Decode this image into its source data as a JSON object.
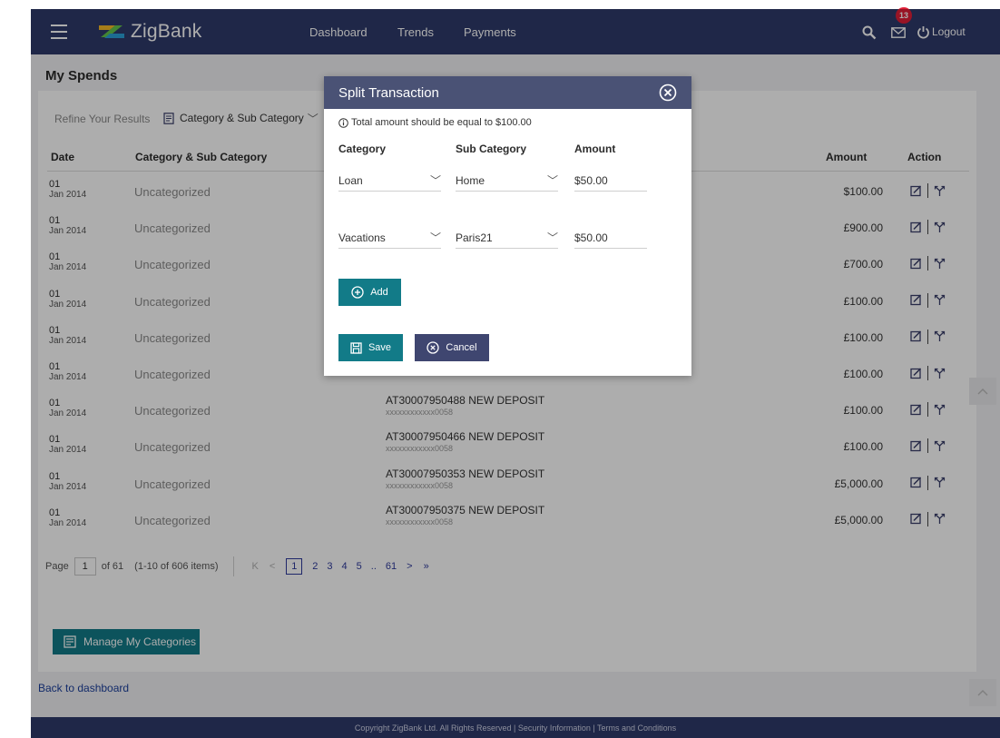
{
  "header": {
    "brand": "ZigBank",
    "nav": [
      "Dashboard",
      "Trends",
      "Payments"
    ],
    "mail_badge": "13",
    "logout": "Logout"
  },
  "page": {
    "title": "My Spends",
    "refine_label": "Refine Your Results",
    "refine_select": "Category & Sub Category",
    "columns": {
      "date": "Date",
      "category": "Category & Sub Category",
      "amount": "Amount",
      "action": "Action"
    },
    "rows": [
      {
        "day": "01",
        "month": "Jan 2014",
        "category": "Uncategorized",
        "desc": "",
        "acct": "",
        "amount": "$100.00"
      },
      {
        "day": "01",
        "month": "Jan 2014",
        "category": "Uncategorized",
        "desc": "",
        "acct": "",
        "amount": "£900.00"
      },
      {
        "day": "01",
        "month": "Jan 2014",
        "category": "Uncategorized",
        "desc": "",
        "acct": "",
        "amount": "£700.00"
      },
      {
        "day": "01",
        "month": "Jan 2014",
        "category": "Uncategorized",
        "desc": "",
        "acct": "",
        "amount": "£100.00"
      },
      {
        "day": "01",
        "month": "Jan 2014",
        "category": "Uncategorized",
        "desc": "",
        "acct": "",
        "amount": "£100.00"
      },
      {
        "day": "01",
        "month": "Jan 2014",
        "category": "Uncategorized",
        "desc": "",
        "acct": "xxxxxxxxxxxx0058",
        "amount": "£100.00"
      },
      {
        "day": "01",
        "month": "Jan 2014",
        "category": "Uncategorized",
        "desc": "AT30007950488 NEW DEPOSIT",
        "acct": "xxxxxxxxxxxx0058",
        "amount": "£100.00"
      },
      {
        "day": "01",
        "month": "Jan 2014",
        "category": "Uncategorized",
        "desc": "AT30007950466 NEW DEPOSIT",
        "acct": "xxxxxxxxxxxx0058",
        "amount": "£100.00"
      },
      {
        "day": "01",
        "month": "Jan 2014",
        "category": "Uncategorized",
        "desc": "AT30007950353 NEW DEPOSIT",
        "acct": "xxxxxxxxxxxx0058",
        "amount": "£5,000.00"
      },
      {
        "day": "01",
        "month": "Jan 2014",
        "category": "Uncategorized",
        "desc": "AT30007950375 NEW DEPOSIT",
        "acct": "xxxxxxxxxxxx0058",
        "amount": "£5,000.00"
      }
    ],
    "pagination": {
      "page_label": "Page",
      "current": "1",
      "of_label": "of 61",
      "items": "(1-10 of 606 items)",
      "first": "K",
      "prev": "<",
      "pages": [
        "2",
        "3",
        "4",
        "5"
      ],
      "ellipsis": "..",
      "last_page": "61",
      "next": ">",
      "last": "»"
    },
    "manage_button": "Manage My Categories",
    "back_link": "Back to dashboard"
  },
  "footer": "Copyright ZigBank Ltd. All Rights Reserved | Security Information | Terms and Conditions",
  "modal": {
    "title": "Split Transaction",
    "note": "Total amount should be equal to $100.00",
    "col_category": "Category",
    "col_subcategory": "Sub Category",
    "col_amount": "Amount",
    "splits": [
      {
        "category": "Loan",
        "subcategory": "Home",
        "amount": "$50.00"
      },
      {
        "category": "Vacations",
        "subcategory": "Paris21",
        "amount": "$50.00"
      }
    ],
    "add_label": "Add",
    "save_label": "Save",
    "cancel_label": "Cancel"
  },
  "colors": {
    "header_bg": "#2f3a6b",
    "teal_button": "#127b88",
    "modal_header": "#4a5275",
    "badge": "#e01e37"
  }
}
